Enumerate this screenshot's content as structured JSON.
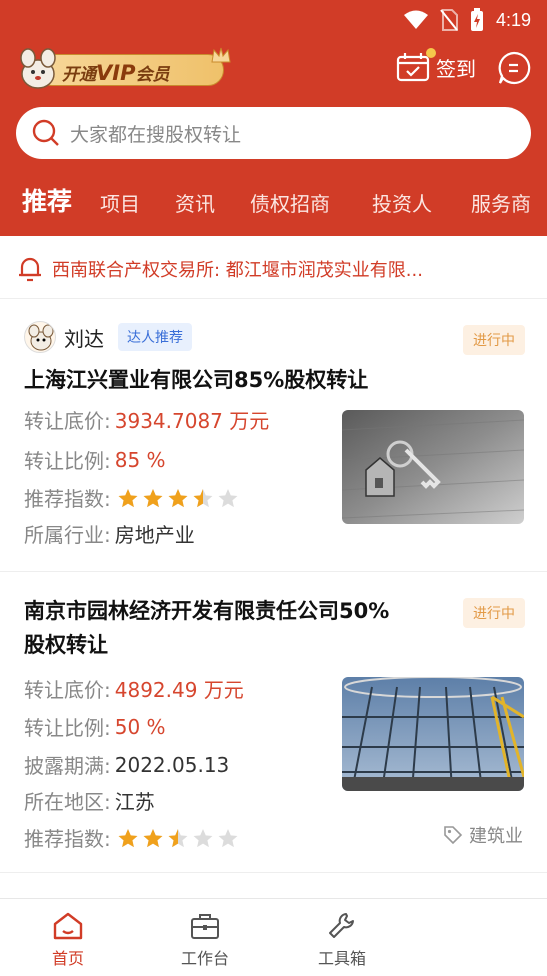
{
  "status_bar": {
    "time": "4:19"
  },
  "header": {
    "vip": {
      "prefix": "开通",
      "big": "VIP",
      "suffix": "会员"
    },
    "sign_in_label": "签到",
    "search_placeholder": "大家都在搜股权转让",
    "tabs": [
      "推荐",
      "项目",
      "资讯",
      "债权招商",
      "投资人",
      "服务商"
    ]
  },
  "notice": {
    "text": "西南联合产权交易所: 都江堰市润茂实业有限..."
  },
  "cards": [
    {
      "user": "刘达",
      "user_tag": "达人推荐",
      "status": "进行中",
      "title": "上海江兴置业有限公司85%股权转让",
      "fields": [
        {
          "label": "转让底价:",
          "value": "3934.7087 万元"
        },
        {
          "label": "转让比例:",
          "value": "85 %"
        },
        {
          "label": "推荐指数:",
          "rating": 3.5
        },
        {
          "label": "所属行业:",
          "value": "房地产业"
        }
      ]
    },
    {
      "status": "进行中",
      "title_line1": "南京市园林经济开发有限责任公司50%",
      "title_line2": "股权转让",
      "fields": [
        {
          "label": "转让底价:",
          "value": "4892.49 万元"
        },
        {
          "label": "转让比例:",
          "value": "50 %"
        },
        {
          "label": "披露期满:",
          "value": "2022.05.13"
        },
        {
          "label": "所在地区:",
          "value": "江苏"
        },
        {
          "label": "推荐指数:",
          "rating": 2.5
        }
      ],
      "industry": "建筑业"
    }
  ],
  "bottom_nav": [
    "首页",
    "工作台",
    "工具箱"
  ],
  "colors": {
    "brand": "#d13c27",
    "price": "#d6462e",
    "star": "#f0a11c",
    "status": "#e29a47",
    "tag_blue": "#3a6fd8"
  }
}
